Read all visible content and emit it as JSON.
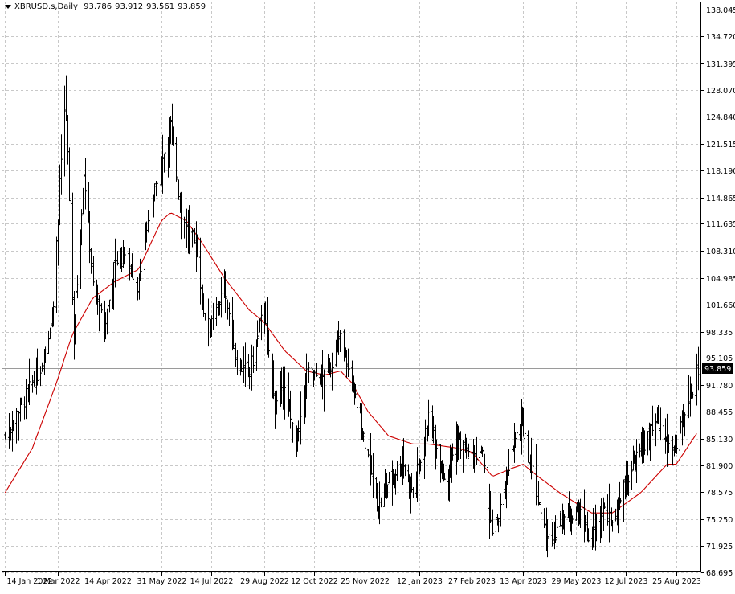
{
  "header": {
    "symbol": "XBRUSD.s,Daily",
    "open": "93.786",
    "high": "93.912",
    "low": "93.561",
    "close": "93.859"
  },
  "colors": {
    "background": "#ffffff",
    "bars": "#000000",
    "grid": "#c8c8c8",
    "moving_average": "#cc0000",
    "current_price_tag_bg": "#000000",
    "current_price_tag_text": "#ffffff"
  },
  "chart_data": {
    "type": "ohlc",
    "symbol": "XBRUSD.s",
    "timeframe": "Daily",
    "grid": true,
    "y_axis_side": "right",
    "ylim": [
      68.695,
      139.0
    ],
    "y_ticks": [
      "138.045",
      "134.720",
      "131.395",
      "128.070",
      "124.840",
      "121.515",
      "118.190",
      "114.865",
      "111.635",
      "108.310",
      "104.985",
      "101.660",
      "98.335",
      "95.105",
      "91.780",
      "88.455",
      "85.130",
      "81.900",
      "78.575",
      "75.250",
      "71.925",
      "68.695"
    ],
    "x_ticks": [
      "14 Jan 2022",
      "1 Mar 2022",
      "14 Apr 2022",
      "31 May 2022",
      "14 Jul 2022",
      "29 Aug 2022",
      "12 Oct 2022",
      "25 Nov 2022",
      "12 Jan 2023",
      "27 Feb 2023",
      "13 Apr 2023",
      "29 May 2023",
      "12 Jul 2023",
      "25 Aug 2023"
    ],
    "current_price": "93.859",
    "price_anchors": [
      [
        "2022-01-14",
        85.5
      ],
      [
        "2022-01-31",
        90.0
      ],
      [
        "2022-02-14",
        94.0
      ],
      [
        "2022-02-24",
        100.0
      ],
      [
        "2022-03-08",
        128.0
      ],
      [
        "2022-03-15",
        98.0
      ],
      [
        "2022-03-24",
        118.0
      ],
      [
        "2022-04-01",
        104.0
      ],
      [
        "2022-04-11",
        98.5
      ],
      [
        "2022-04-20",
        107.0
      ],
      [
        "2022-04-29",
        108.0
      ],
      [
        "2022-05-11",
        104.0
      ],
      [
        "2022-05-19",
        112.0
      ],
      [
        "2022-06-08",
        123.5
      ],
      [
        "2022-06-17",
        113.0
      ],
      [
        "2022-06-22",
        111.0
      ],
      [
        "2022-06-30",
        109.0
      ],
      [
        "2022-07-07",
        101.0
      ],
      [
        "2022-07-14",
        99.0
      ],
      [
        "2022-07-25",
        104.0
      ],
      [
        "2022-08-05",
        94.5
      ],
      [
        "2022-08-16",
        93.0
      ],
      [
        "2022-08-29",
        101.5
      ],
      [
        "2022-09-07",
        89.0
      ],
      [
        "2022-09-16",
        91.0
      ],
      [
        "2022-09-26",
        84.0
      ],
      [
        "2022-10-05",
        93.0
      ],
      [
        "2022-10-12",
        93.0
      ],
      [
        "2022-10-21",
        92.5
      ],
      [
        "2022-11-04",
        97.5
      ],
      [
        "2022-11-14",
        92.0
      ],
      [
        "2022-11-28",
        83.0
      ],
      [
        "2022-12-07",
        76.5
      ],
      [
        "2022-12-16",
        80.0
      ],
      [
        "2022-12-28",
        82.5
      ],
      [
        "2023-01-06",
        78.5
      ],
      [
        "2023-01-20",
        87.5
      ],
      [
        "2023-02-03",
        80.5
      ],
      [
        "2023-02-14",
        85.0
      ],
      [
        "2023-02-27",
        82.5
      ],
      [
        "2023-03-07",
        84.0
      ],
      [
        "2023-03-17",
        73.0
      ],
      [
        "2023-03-28",
        78.5
      ],
      [
        "2023-04-03",
        84.5
      ],
      [
        "2023-04-13",
        86.5
      ],
      [
        "2023-04-26",
        78.0
      ],
      [
        "2023-05-04",
        72.5
      ],
      [
        "2023-05-15",
        75.0
      ],
      [
        "2023-05-29",
        76.5
      ],
      [
        "2023-06-12",
        72.5
      ],
      [
        "2023-06-21",
        76.5
      ],
      [
        "2023-06-30",
        75.0
      ],
      [
        "2023-07-12",
        80.0
      ],
      [
        "2023-07-25",
        84.0
      ],
      [
        "2023-08-09",
        87.0
      ],
      [
        "2023-08-17",
        84.5
      ],
      [
        "2023-08-25",
        84.0
      ],
      [
        "2023-09-05",
        90.0
      ],
      [
        "2023-09-13",
        93.86
      ]
    ],
    "moving_average": [
      [
        "2022-01-14",
        78.5
      ],
      [
        "2022-02-07",
        84.0
      ],
      [
        "2022-02-28",
        92.0
      ],
      [
        "2022-03-14",
        98.0
      ],
      [
        "2022-04-01",
        102.5
      ],
      [
        "2022-04-20",
        104.5
      ],
      [
        "2022-05-11",
        106.0
      ],
      [
        "2022-05-31",
        112.0
      ],
      [
        "2022-06-08",
        113.0
      ],
      [
        "2022-06-22",
        112.0
      ],
      [
        "2022-07-07",
        109.0
      ],
      [
        "2022-07-25",
        105.0
      ],
      [
        "2022-08-16",
        101.0
      ],
      [
        "2022-08-29",
        99.5
      ],
      [
        "2022-09-16",
        96.0
      ],
      [
        "2022-10-05",
        93.5
      ],
      [
        "2022-10-21",
        93.0
      ],
      [
        "2022-11-04",
        93.5
      ],
      [
        "2022-11-14",
        92.0
      ],
      [
        "2022-11-28",
        88.5
      ],
      [
        "2022-12-16",
        85.5
      ],
      [
        "2023-01-06",
        84.5
      ],
      [
        "2023-01-20",
        84.5
      ],
      [
        "2023-02-14",
        84.0
      ],
      [
        "2023-02-27",
        83.5
      ],
      [
        "2023-03-17",
        80.5
      ],
      [
        "2023-04-03",
        81.5
      ],
      [
        "2023-04-13",
        82.0
      ],
      [
        "2023-04-26",
        80.5
      ],
      [
        "2023-05-15",
        78.5
      ],
      [
        "2023-06-12",
        76.0
      ],
      [
        "2023-06-30",
        76.0
      ],
      [
        "2023-07-25",
        78.5
      ],
      [
        "2023-08-17",
        82.0
      ],
      [
        "2023-08-25",
        82.0
      ],
      [
        "2023-09-13",
        86.0
      ]
    ]
  }
}
